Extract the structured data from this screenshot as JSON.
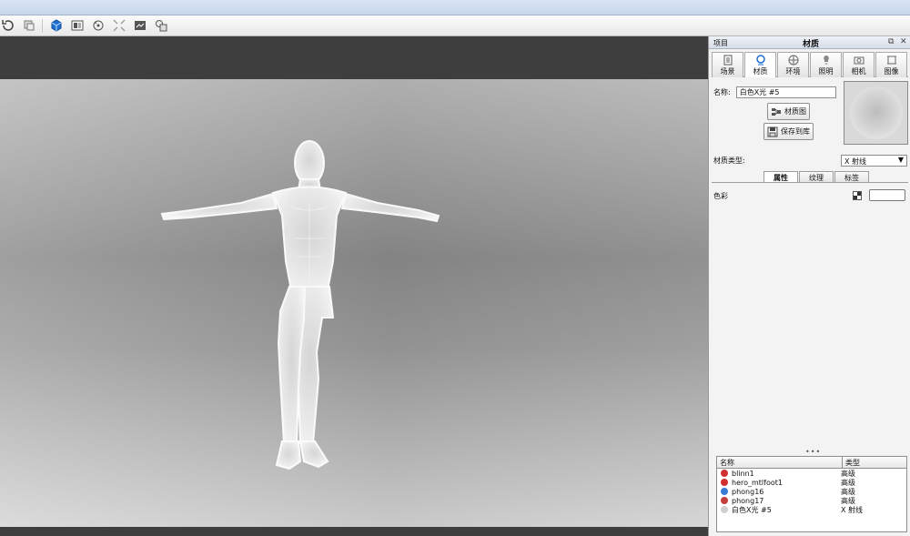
{
  "toolbar": {
    "icons": [
      "refresh-icon",
      "copy-icon",
      "cube-icon",
      "panel-icon",
      "camera-rotate-icon",
      "expand-icon",
      "render-icon",
      "layers-icon"
    ]
  },
  "panel": {
    "header_left": "项目",
    "header_title": "材质",
    "header_controls": [
      "⧉",
      "✕"
    ],
    "tabs": [
      {
        "label": "场景",
        "icon": "scene-icon"
      },
      {
        "label": "材质",
        "icon": "material-icon"
      },
      {
        "label": "环境",
        "icon": "globe-icon"
      },
      {
        "label": "照明",
        "icon": "light-icon"
      },
      {
        "label": "相机",
        "icon": "camera-icon"
      },
      {
        "label": "图像",
        "icon": "image-icon"
      }
    ],
    "name_label": "名称:",
    "name_value": "白色X光 #5",
    "material_graph_button": "材质图",
    "save_to_library_button": "保存到库",
    "material_type_label": "材质类型:",
    "material_type_value": "X 射线",
    "subtabs": [
      "属性",
      "纹理",
      "标签"
    ],
    "color_label": "色彩",
    "dots": "•••",
    "list": {
      "columns": [
        "名称",
        "类型"
      ],
      "rows": [
        {
          "name": "blinn1",
          "type": "高级",
          "color": "#d23030"
        },
        {
          "name": "hero_mtlfoot1",
          "type": "高级",
          "color": "#d23030"
        },
        {
          "name": "phong16",
          "type": "高级",
          "color": "#3a7bd5"
        },
        {
          "name": "phong17",
          "type": "高级",
          "color": "#c43d3d"
        },
        {
          "name": "白色X光 #5",
          "type": "X 射线",
          "color": "#cfcfcf"
        }
      ]
    }
  }
}
